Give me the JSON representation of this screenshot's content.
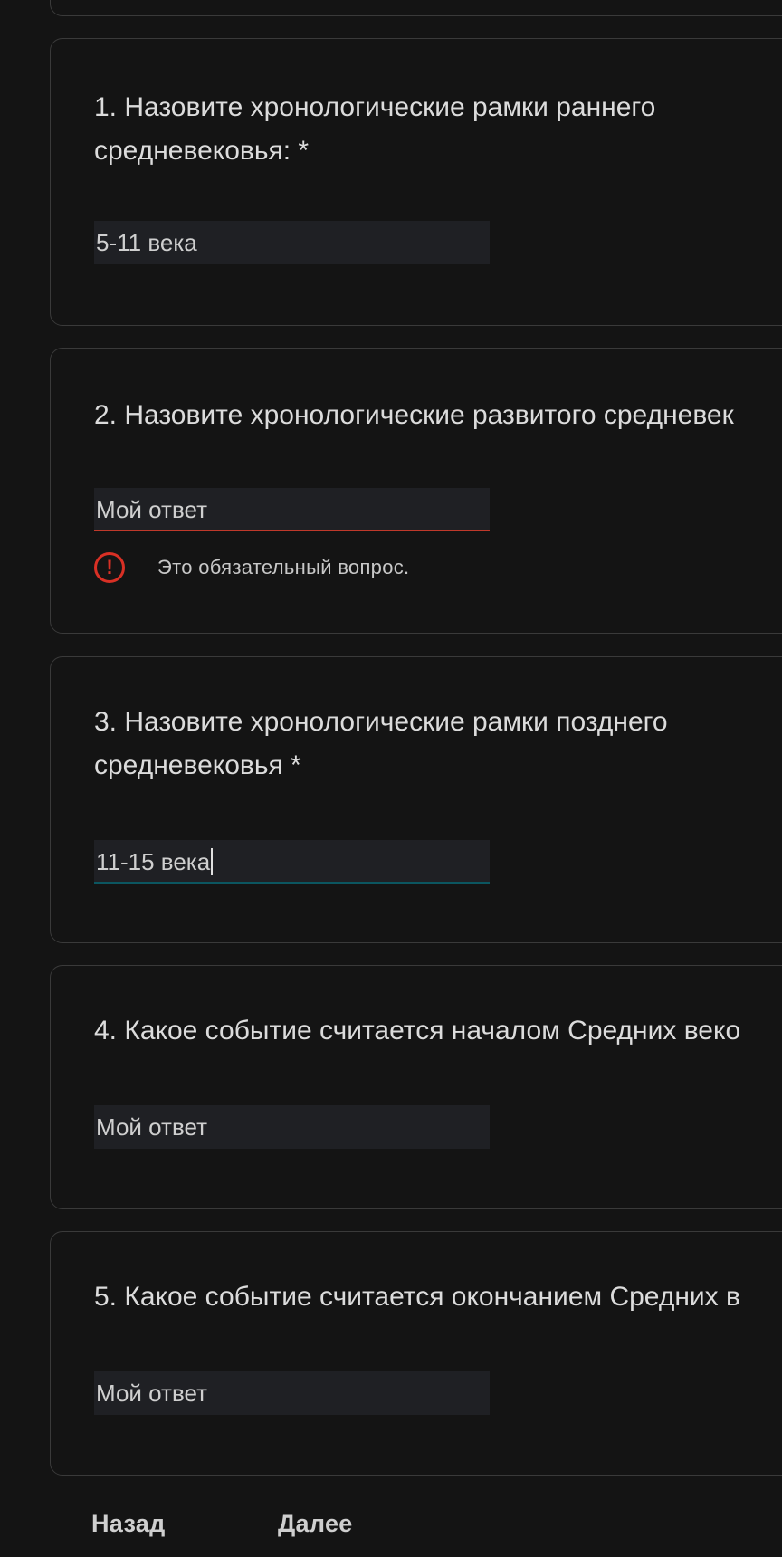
{
  "questions": [
    {
      "title": "1. Назовите хронологические рамки раннего\nсредневековья: *",
      "answer": "5-11 века"
    },
    {
      "title": "2. Назовите хронологические развитого средневек",
      "placeholder": "Мой ответ",
      "error": "Это обязательный вопрос."
    },
    {
      "title": "3. Назовите хронологические рамки позднего\nсредневековья *",
      "answer": "11-15 века"
    },
    {
      "title": "4. Какое событие считается началом Средних веко",
      "placeholder": "Мой ответ"
    },
    {
      "title": "5. Какое событие считается окончанием Средних в",
      "placeholder": "Мой ответ"
    }
  ],
  "nav": {
    "back_label": "Назад",
    "next_label": "Далее"
  },
  "icons": {
    "error": "alert-circle-icon"
  },
  "colors": {
    "error": "#d93025",
    "focus_underline": "#0b5660",
    "field_bg": "#1f2024",
    "page_bg": "#141414"
  }
}
